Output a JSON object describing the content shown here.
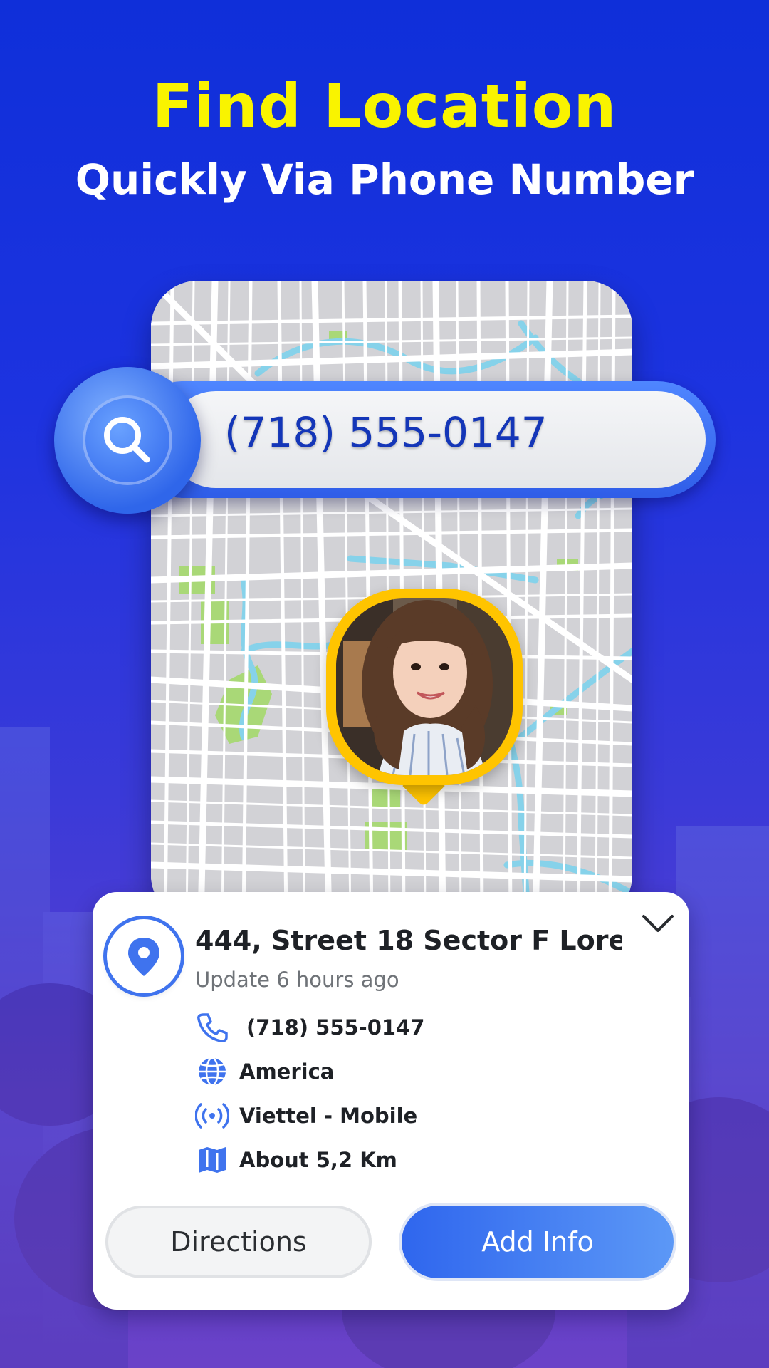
{
  "header": {
    "title": "Find Location",
    "subtitle": "Quickly Via Phone Number"
  },
  "search": {
    "value": "(718) 555-0147",
    "icon": "search-icon"
  },
  "map": {
    "pin_avatar": "avatar"
  },
  "card": {
    "address": "444, Street 18 Sector F Lore ...",
    "updated": "Update 6 hours ago",
    "details": [
      {
        "icon": "phone-icon",
        "text": "(718) 555-0147"
      },
      {
        "icon": "globe-icon",
        "text": "America"
      },
      {
        "icon": "signal-icon",
        "text": "Viettel - Mobile"
      },
      {
        "icon": "map-icon",
        "text": "About 5,2 Km"
      }
    ],
    "directions_label": "Directions",
    "add_info_label": "Add Info"
  },
  "colors": {
    "background": "#1d33e0",
    "headline": "#f9f300",
    "accent": "#3f73ee",
    "pin": "#ffc400"
  }
}
